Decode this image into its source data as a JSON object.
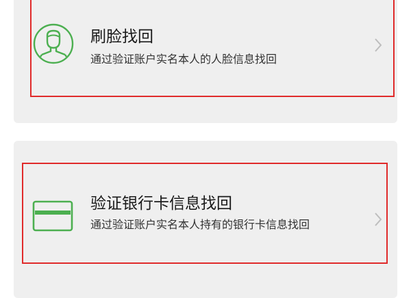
{
  "options": [
    {
      "title": "刷脸找回",
      "description": "通过验证账户实名本人的人脸信息找回",
      "icon": "face-scan-icon"
    },
    {
      "title": "验证银行卡信息找回",
      "description": "通过验证账户实名本人持有的银行卡信息找回",
      "icon": "bank-card-icon"
    }
  ],
  "colors": {
    "accent": "#4caf50",
    "highlight_border": "#e02a2a",
    "panel_background": "#efefef",
    "chevron": "#bdbdbd"
  }
}
